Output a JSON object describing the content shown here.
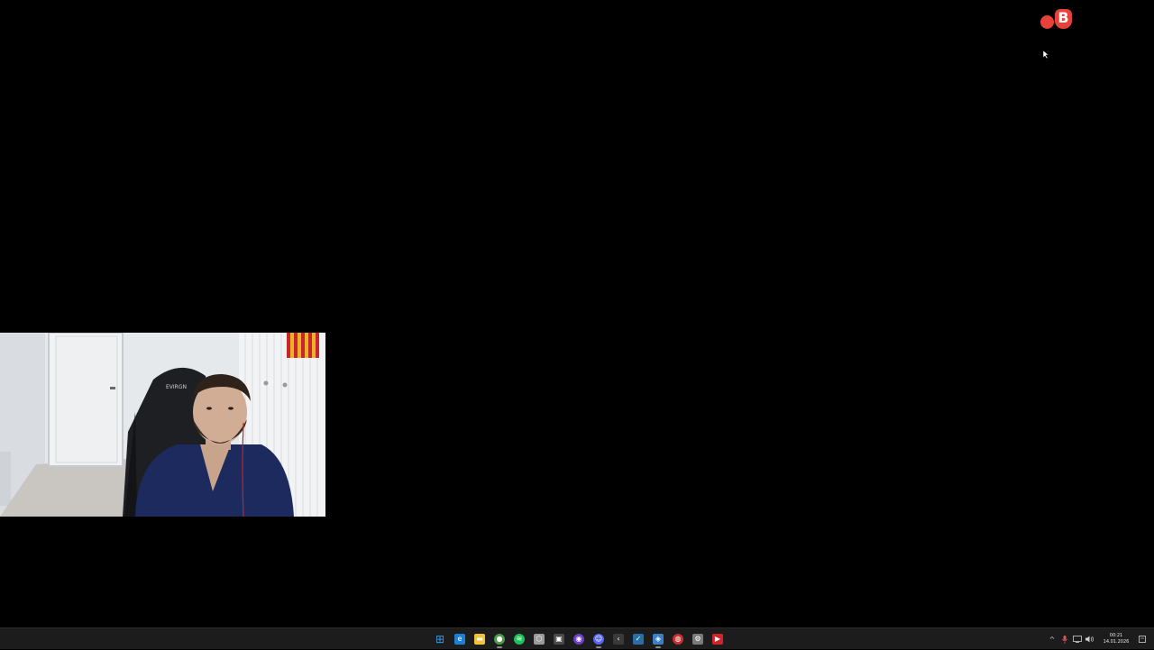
{
  "overlay": {
    "logo_letter": "B",
    "logo_color": "#e8403a"
  },
  "webcam": {
    "chair_brand_text": "EVIRGN"
  },
  "taskbar": {
    "pinned": [
      {
        "name": "start-icon",
        "symbol": "⊞",
        "color": "#2f9be8",
        "active": false
      },
      {
        "name": "edge-icon",
        "symbol": "e",
        "color": "#1c7fd6",
        "active": false
      },
      {
        "name": "file-explorer-icon",
        "symbol": "▬",
        "color": "#f2c23a",
        "active": false
      },
      {
        "name": "chrome-icon",
        "symbol": "●",
        "color": "#4d9a4a",
        "active": true
      },
      {
        "name": "spotify-icon",
        "symbol": "≋",
        "color": "#1ec25a",
        "active": false
      },
      {
        "name": "unity-icon",
        "symbol": "⬡",
        "color": "#9a9a9a",
        "active": false
      },
      {
        "name": "app-icon",
        "symbol": "▣",
        "color": "#4a4a4a",
        "active": false
      },
      {
        "name": "github-icon",
        "symbol": "◉",
        "color": "#6e40c9",
        "active": false
      },
      {
        "name": "discord-icon",
        "symbol": "☺",
        "color": "#5865f2",
        "active": true
      },
      {
        "name": "kick-icon",
        "symbol": "‹",
        "color": "#3a3a3a",
        "active": false
      },
      {
        "name": "steam-icon",
        "symbol": "✓",
        "color": "#2a6ea8",
        "active": false
      },
      {
        "name": "browser-icon",
        "symbol": "◈",
        "color": "#3d7fc4",
        "active": true
      },
      {
        "name": "record-icon",
        "symbol": "◍",
        "color": "#c93030",
        "active": false
      },
      {
        "name": "settings-icon",
        "symbol": "⚙",
        "color": "#7a7a7a",
        "active": false
      },
      {
        "name": "media-player-icon",
        "symbol": "▶",
        "color": "#d0242a",
        "active": false
      }
    ],
    "tray": {
      "chevron": "^",
      "mic": "🎙",
      "network": "▭",
      "volume": "◀)",
      "time": "00:21",
      "date": "14.01.2026",
      "notifications": "▢"
    }
  }
}
